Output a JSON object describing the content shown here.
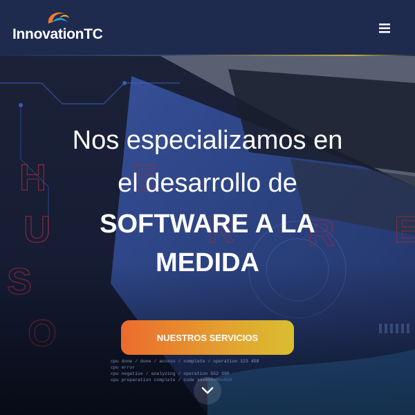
{
  "header": {
    "brand": "InnovationTC",
    "logo_icon": "innovationtc-swirl-logo",
    "menu_icon": "hamburger-menu-icon"
  },
  "hero": {
    "headline_line1": "Nos especializamos en",
    "headline_line2": "el desarrollo de",
    "headline_line3": "SOFTWARE A LA",
    "headline_line4": "MEDIDA",
    "cta_label": "NUESTROS SERVICIOS",
    "scroll_icon": "chevron-down-icon",
    "background_letters_left": [
      "H",
      "U",
      "S",
      "O"
    ],
    "background_letters_right": [
      "E",
      "R",
      "R",
      "E"
    ],
    "background_code_lines": [
      "cpu  done / done / access / complete / operation 123 458",
      "cpu  error",
      "cpu  negative / analyzing / operation 552 390",
      "cpu  preparation complete / code xxx000x0xx0x0"
    ]
  },
  "colors": {
    "header_bg": "#1e2b4f",
    "cta_start": "#ec6b2d",
    "cta_end": "#d9be30",
    "logo_orange": "#f07a2a",
    "logo_blue": "#2a9bd8"
  }
}
